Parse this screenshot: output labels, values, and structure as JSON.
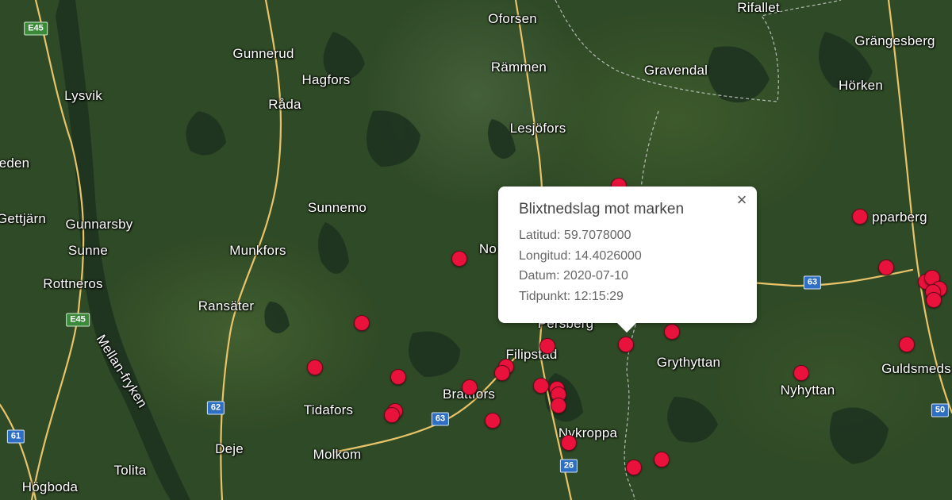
{
  "map": {
    "places": [
      {
        "id": "oforsen",
        "name": "Oforsen"
      },
      {
        "id": "rifallet",
        "name": "Rifallet"
      },
      {
        "id": "grangesberg",
        "name": "Grängesberg"
      },
      {
        "id": "gunnerud",
        "name": "Gunnerud"
      },
      {
        "id": "rammen",
        "name": "Rämmen"
      },
      {
        "id": "gravendal",
        "name": "Gravendal"
      },
      {
        "id": "hagfors",
        "name": "Hagfors"
      },
      {
        "id": "horken",
        "name": "Hörken"
      },
      {
        "id": "lysvik",
        "name": "Lysvik"
      },
      {
        "id": "rada",
        "name": "Råda"
      },
      {
        "id": "lesjofors",
        "name": "Lesjöfors"
      },
      {
        "id": "eden",
        "name": "eden"
      },
      {
        "id": "sunnemo",
        "name": "Sunnemo"
      },
      {
        "id": "gettjarn",
        "name": "Gettjärn"
      },
      {
        "id": "gunnarsby",
        "name": "Gunnarsby"
      },
      {
        "id": "opparberg",
        "name": "pparberg"
      },
      {
        "id": "munkfors",
        "name": "Munkfors"
      },
      {
        "id": "sunne",
        "name": "Sunne"
      },
      {
        "id": "no",
        "name": "No"
      },
      {
        "id": "rottneros",
        "name": "Rottneros"
      },
      {
        "id": "ransater",
        "name": "Ransäter"
      },
      {
        "id": "persberg",
        "name": "Persberg"
      },
      {
        "id": "filipstad",
        "name": "Filipstad"
      },
      {
        "id": "grythyttan",
        "name": "Grythyttan"
      },
      {
        "id": "guldsmeds",
        "name": "Guldsmeds"
      },
      {
        "id": "mellanfryken",
        "name": "Mellan-fryken"
      },
      {
        "id": "nyhyttan",
        "name": "Nyhyttan"
      },
      {
        "id": "brattfors",
        "name": "Brattfors"
      },
      {
        "id": "tidafors",
        "name": "Tidafors"
      },
      {
        "id": "nykroppa",
        "name": "Nykroppa"
      },
      {
        "id": "deje",
        "name": "Deje"
      },
      {
        "id": "molkom",
        "name": "Molkom"
      },
      {
        "id": "tolita",
        "name": "Tolita"
      },
      {
        "id": "hogboda",
        "name": "Högboda"
      }
    ],
    "road_shields": [
      {
        "id": "e45-top",
        "label": "E45",
        "type": "e"
      },
      {
        "id": "e45-mid",
        "label": "E45",
        "type": "e"
      },
      {
        "id": "r62",
        "label": "62",
        "type": "n"
      },
      {
        "id": "r63-west",
        "label": "63",
        "type": "n"
      },
      {
        "id": "r63-east",
        "label": "63",
        "type": "n"
      },
      {
        "id": "r61",
        "label": "61",
        "type": "n"
      },
      {
        "id": "r26",
        "label": "26",
        "type": "n"
      },
      {
        "id": "r50",
        "label": "50",
        "type": "n"
      }
    ],
    "marker_count": 33,
    "marker_color": "#e8123c"
  },
  "popup": {
    "title": "Blixtnedslag mot marken",
    "lat_label": "Latitud: 59.7078000",
    "lon_label": "Longitud: 14.4026000",
    "date_label": "Datum: 2020-07-10",
    "time_label": "Tidpunkt: 12:15:29",
    "close_glyph": "×"
  }
}
